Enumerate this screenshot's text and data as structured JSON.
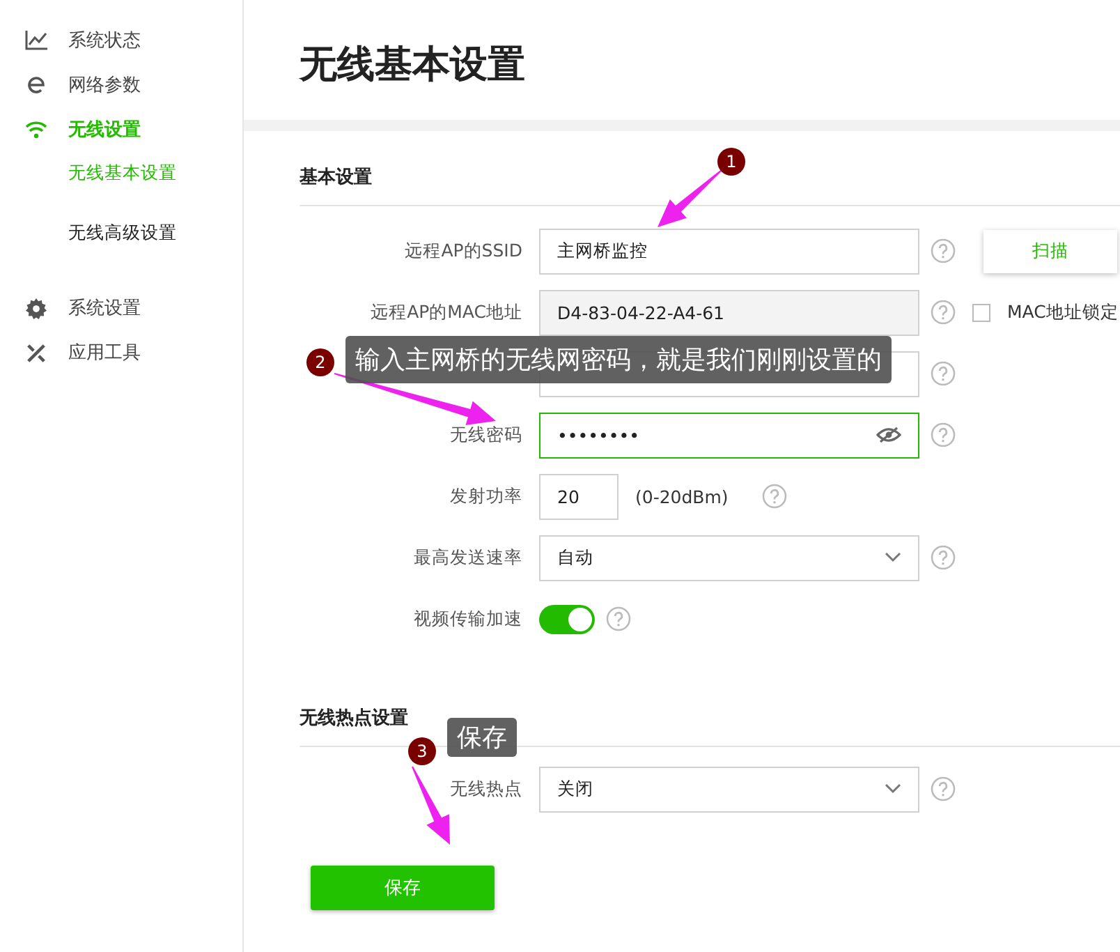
{
  "sidebar": {
    "items": [
      {
        "kind": "chart",
        "label": "系统状态",
        "selected": false
      },
      {
        "kind": "globe",
        "label": "网络参数",
        "selected": false
      },
      {
        "kind": "wifi",
        "label": "无线设置",
        "selected": true,
        "children": [
          {
            "label": "无线基本设置",
            "selected": true
          },
          {
            "label": "无线高级设置",
            "selected": false
          }
        ]
      },
      {
        "kind": "gear",
        "label": "系统设置",
        "selected": false
      },
      {
        "kind": "tools",
        "label": "应用工具",
        "selected": false
      }
    ]
  },
  "page_title": "无线基本设置",
  "sections": [
    {
      "title": "基本设置",
      "rows": [
        {
          "kind": "text",
          "label": "远程AP的SSID",
          "value": "主网桥监控",
          "focused": false,
          "disabled": false,
          "button": "扫描"
        },
        {
          "kind": "text",
          "label": "远程AP的MAC地址",
          "value": "D4-83-04-22-A4-61",
          "focused": false,
          "disabled": true,
          "checkbox": {
            "label": "MAC地址锁定",
            "checked": false
          }
        },
        {
          "kind": "covered"
        },
        {
          "kind": "password",
          "label": "无线密码",
          "value": "••••••••",
          "focused": true
        },
        {
          "kind": "number",
          "label": "发射功率",
          "value": "20",
          "unit": "(0-20dBm)"
        },
        {
          "kind": "select",
          "label": "最高发送速率",
          "value": "自动"
        },
        {
          "kind": "toggle",
          "label": "视频传输加速",
          "on": true
        }
      ]
    },
    {
      "title": "无线热点设置",
      "rows": [
        {
          "kind": "select",
          "label": "无线热点",
          "value": "关闭"
        }
      ]
    }
  ],
  "save_button": "保存",
  "annotations": [
    {
      "number": "1"
    },
    {
      "number": "2",
      "text": "输入主网桥的无线网密码，就是我们刚刚设置的"
    },
    {
      "number": "3",
      "text": "保存"
    }
  ]
}
